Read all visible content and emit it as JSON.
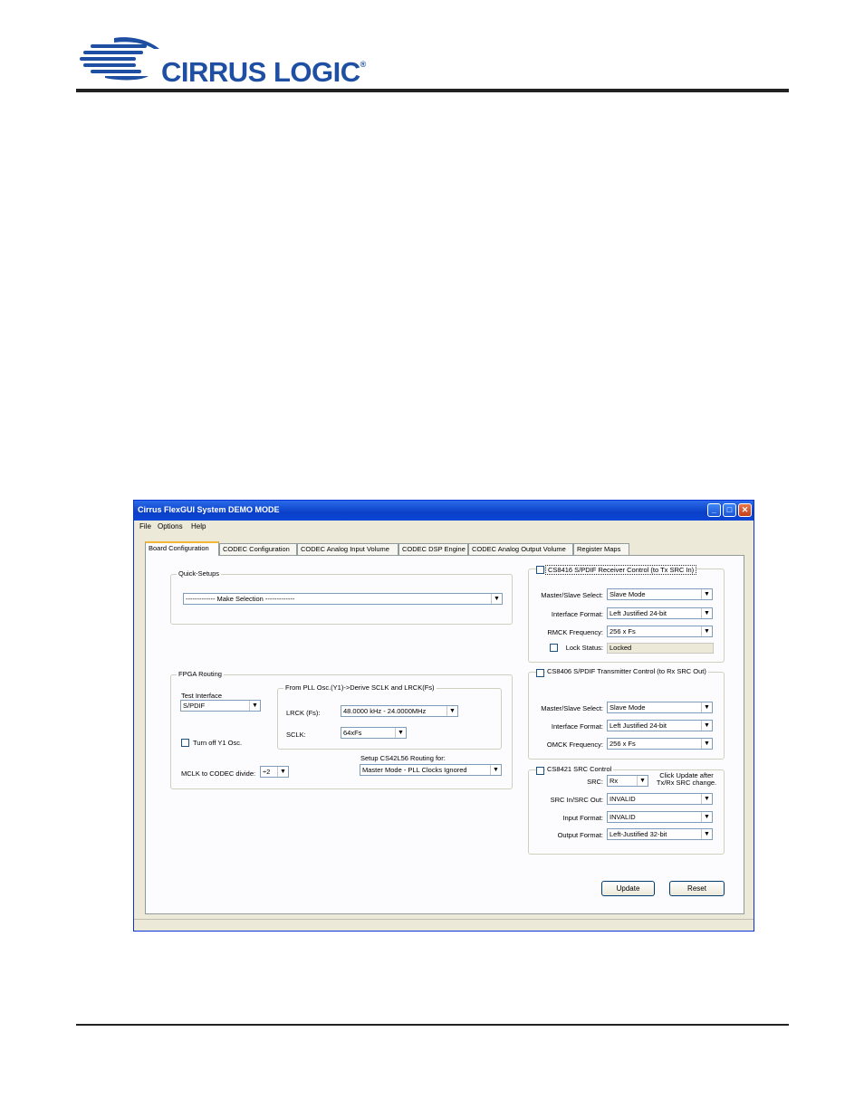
{
  "header": {
    "logo_text": "CIRRUS LOGIC",
    "logo_mark": "®",
    "brand_color": "#1e4fa3"
  },
  "window": {
    "title": "Cirrus FlexGUI System DEMO MODE",
    "titlebar_color": "#0a3fc8",
    "buttons": {
      "minimize": "_",
      "maximize": "□",
      "close": "✕"
    },
    "menu": [
      "File",
      "Options",
      "Help"
    ],
    "tabs": [
      "Board Configuration",
      "CODEC Configuration",
      "CODEC Analog Input Volume",
      "CODEC DSP Engine",
      "CODEC Analog Output Volume",
      "Register Maps"
    ],
    "active_tab": "Board Configuration"
  },
  "quick_setups": {
    "label": "Quick-Setups",
    "value": "------------- Make Selection -------------"
  },
  "fpga": {
    "label": "FPGA Routing",
    "test_interface_label": "Test Interface",
    "test_interface_value": "S/PDIF",
    "turn_off_label": "Turn off Y1 Osc.",
    "mclk_label": "MCLK to CODEC divide:",
    "mclk_value": "÷2",
    "pll_group_label": "From PLL Osc.(Y1)->Derive SCLK and LRCK(Fs)",
    "lrck_label": "LRCK (Fs):",
    "lrck_value": "48.0000 kHz - 24.0000MHz",
    "sclk_label": "SCLK:",
    "sclk_value": "64xFs",
    "routing_label": "Setup CS42L56 Routing for:",
    "routing_value": "Master Mode - PLL Clocks Ignored"
  },
  "receiver": {
    "label": "CS8416 S/PDIF Receiver Control (to Tx SRC In)",
    "ms_label": "Master/Slave Select:",
    "ms_value": "Slave Mode",
    "if_label": "Interface Format:",
    "if_value": "Left Justified 24-bit",
    "rmck_label": "RMCK Frequency:",
    "rmck_value": "256 x Fs",
    "lock_label": "Lock Status:",
    "lock_value": "Locked"
  },
  "transmitter": {
    "label": "CS8406 S/PDIF Transmitter Control (to Rx SRC Out)",
    "ms_label": "Master/Slave Select:",
    "ms_value": "Slave Mode",
    "if_label": "Interface Format:",
    "if_value": "Left Justified 24-bit",
    "omck_label": "OMCK Frequency:",
    "omck_value": "256 x Fs"
  },
  "src": {
    "label": "CS8421 SRC Control",
    "src_label": "SRC:",
    "src_value": "Rx",
    "note": "Click Update after Tx/Rx SRC change.",
    "inout_label": "SRC In/SRC Out:",
    "inout_value": "INVALID",
    "input_label": "Input Format:",
    "input_value": "INVALID",
    "output_label": "Output Format:",
    "output_value": "Left-Justified 32-bit"
  },
  "actions": {
    "update": "Update",
    "reset": "Reset"
  }
}
